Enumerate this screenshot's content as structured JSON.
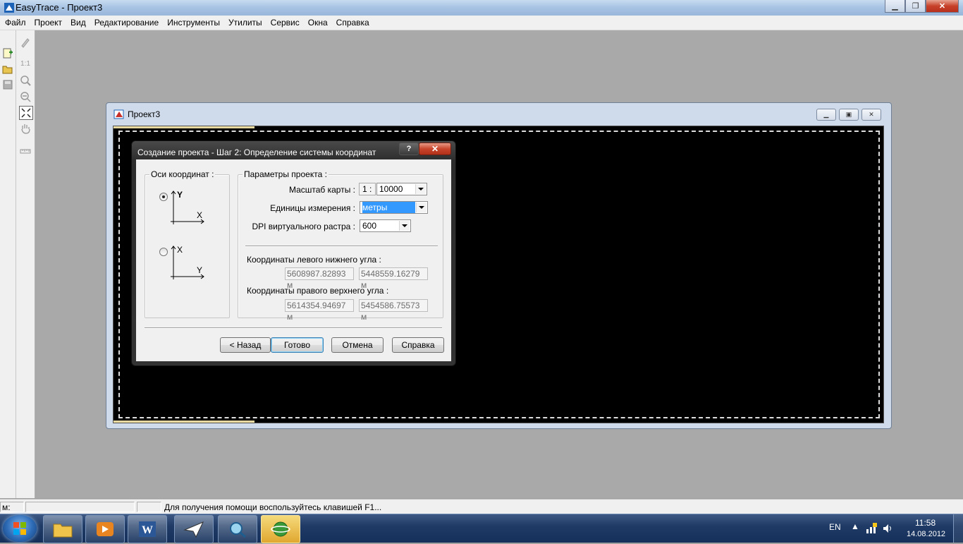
{
  "app": {
    "title": "EasyTrace - Проект3"
  },
  "menu": [
    "Файл",
    "Проект",
    "Вид",
    "Редактирование",
    "Инструменты",
    "Утилиты",
    "Сервис",
    "Окна",
    "Справка"
  ],
  "toolbar": {
    "scale_label": "1:1"
  },
  "child_window": {
    "title": "Проект3"
  },
  "dialog": {
    "title": "Создание проекта - Шаг 2: Определение системы координат",
    "help_glyph": "?",
    "close_glyph": "✕",
    "axes_group": {
      "legend": "Оси координат :",
      "option1": {
        "vertical": "Y",
        "horizontal": "X",
        "checked": true
      },
      "option2": {
        "vertical": "X",
        "horizontal": "Y",
        "checked": false
      }
    },
    "params_group": {
      "legend": "Параметры проекта :",
      "scale_label": "Масштаб карты :",
      "scale_prefix": "1 :",
      "scale_value": "10000",
      "units_label": "Единицы измерения :",
      "units_value": "метры",
      "dpi_label": "DPI виртуального растра :",
      "dpi_value": "600",
      "lower_left_label": "Координаты левого нижнего угла :",
      "lower_left_x": "5608987.82893 м",
      "lower_left_y": "5448559.16279 м",
      "upper_right_label": "Координаты правого верхнего угла :",
      "upper_right_x": "5614354.94697 м",
      "upper_right_y": "5454586.75573 м"
    },
    "buttons": {
      "back": "< Назад",
      "finish": "Готово",
      "cancel": "Отмена",
      "help": "Справка"
    }
  },
  "statusbar": {
    "m_label": "м:",
    "help_text": "Для получения помощи воспользуйтесь клавишей F1..."
  },
  "taskbar": {
    "language": "EN",
    "time": "11:58",
    "date": "14.08.2012"
  }
}
